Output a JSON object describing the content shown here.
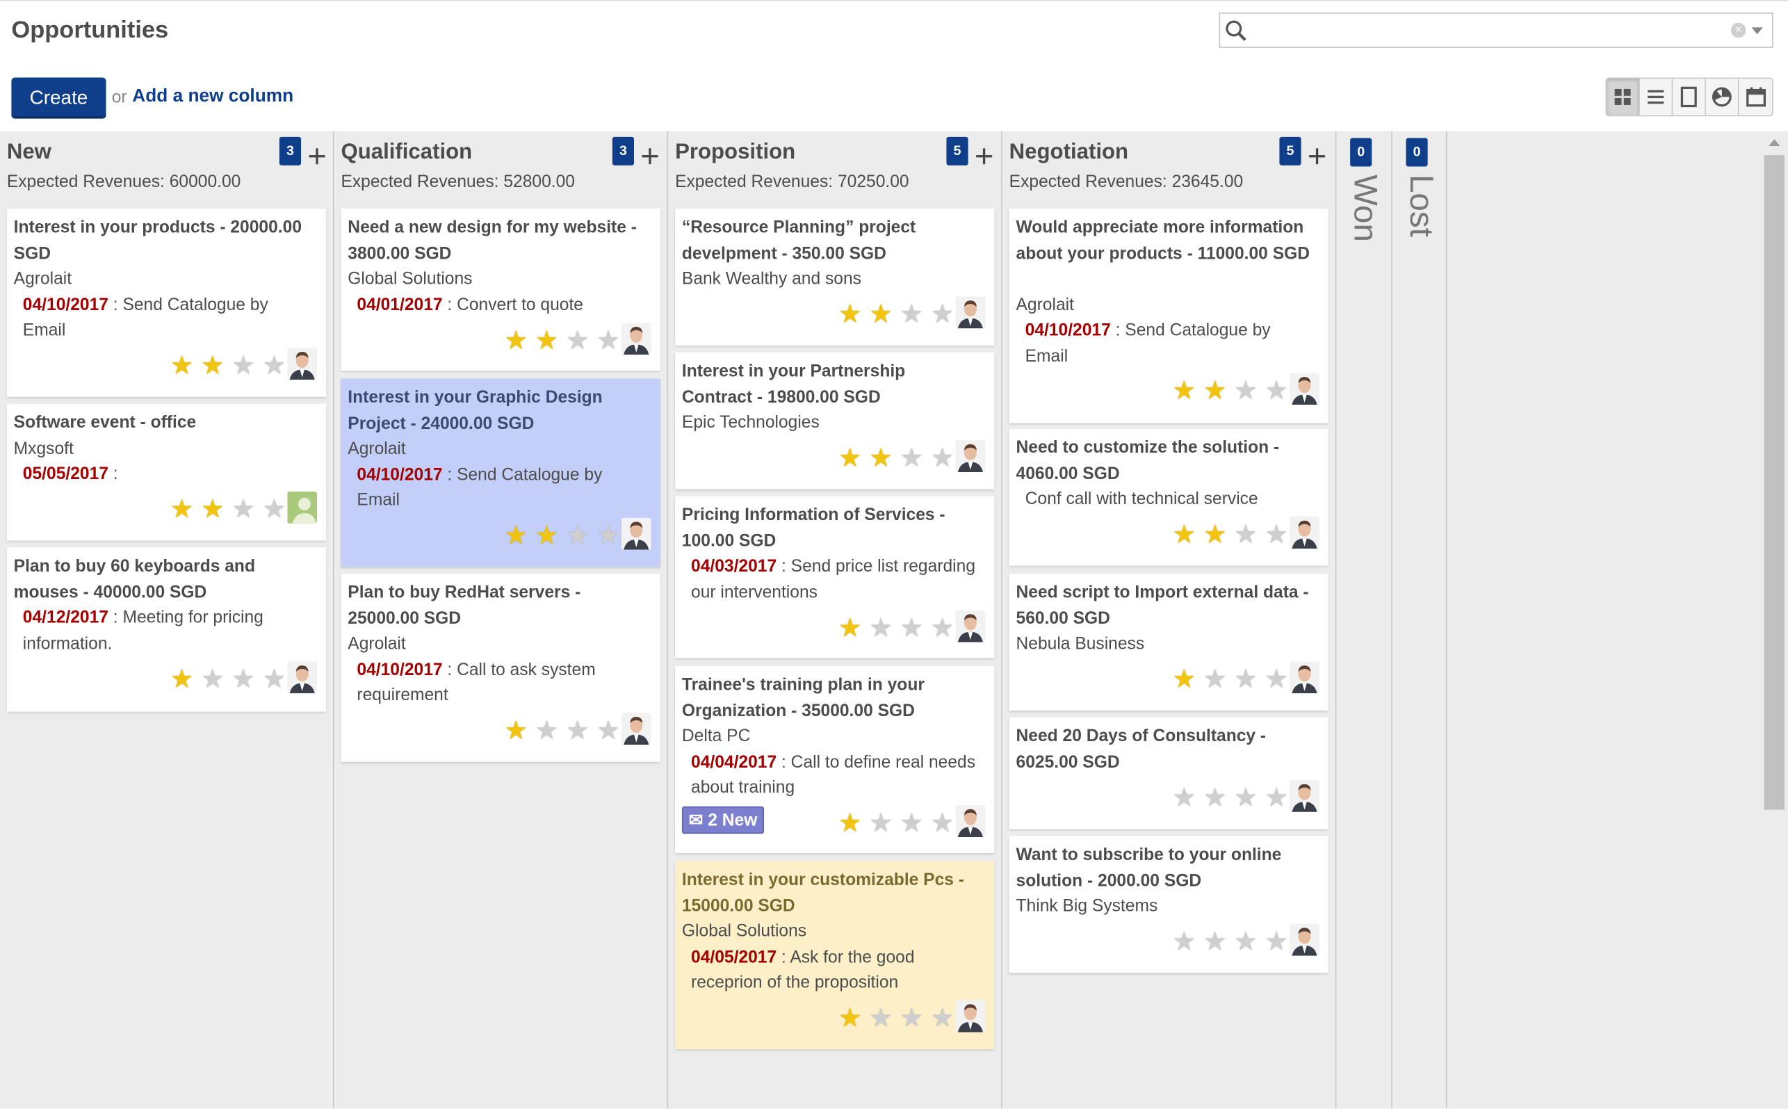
{
  "header": {
    "title": "Opportunities",
    "create_label": "Create",
    "or_label": "or",
    "add_column_label": "Add a new column",
    "search_placeholder": ""
  },
  "views": [
    "kanban-icon",
    "list-icon",
    "form-icon",
    "graph-icon",
    "calendar-icon"
  ],
  "colors": {
    "brand": "#0f3f8a",
    "date": "#a40000",
    "star_on": "#f1c40f",
    "star_off": "#cfcfcf",
    "selected_card": "#c3cff9",
    "highlight_card": "#fdf0c9",
    "new_badge": "#7b7fce"
  },
  "columns": [
    {
      "name": "New",
      "count": "3",
      "revenue": "Expected Revenues: 60000.00",
      "cards": [
        {
          "title": "Interest in your products - 20000.00 SGD",
          "partner": "Agrolait",
          "date": "04/10/2017",
          "action": " : Send Catalogue by Email",
          "stars": 2
        },
        {
          "title": "Software event - office",
          "partner": "Mxgsoft",
          "date": "05/05/2017",
          "action": " :",
          "stars": 2
        },
        {
          "title": "Plan to buy 60 keyboards and mouses - 40000.00 SGD",
          "partner": "",
          "date": "04/12/2017",
          "action": " : Meeting for pricing information.",
          "stars": 1
        }
      ]
    },
    {
      "name": "Qualification",
      "count": "3",
      "revenue": "Expected Revenues: 52800.00",
      "cards": [
        {
          "title": "Need a new design for my website - 3800.00 SGD",
          "partner": "Global Solutions",
          "date": "04/01/2017",
          "action": " : Convert to quote",
          "stars": 2
        },
        {
          "title": "Interest in your Graphic Design Project - 24000.00 SGD",
          "partner": "Agrolait",
          "date": "04/10/2017",
          "action": " : Send Catalogue by Email",
          "stars": 2
        },
        {
          "title": "Plan to buy RedHat servers - 25000.00 SGD",
          "partner": "Agrolait",
          "date": "04/10/2017",
          "action": " : Call to ask system requirement",
          "stars": 1
        }
      ]
    },
    {
      "name": "Proposition",
      "count": "5",
      "revenue": "Expected Revenues: 70250.00",
      "cards": [
        {
          "title": "“Resource Planning” project develpment - 350.00 SGD",
          "partner": "Bank Wealthy and sons",
          "date": "",
          "action": "",
          "stars": 2
        },
        {
          "title": "Interest in your Partnership Contract - 19800.00 SGD",
          "partner": "Epic Technologies",
          "date": "",
          "action": "",
          "stars": 2
        },
        {
          "title": "Pricing Information of Services - 100.00 SGD",
          "partner": "",
          "date": "04/03/2017",
          "action": " : Send price list regarding our interventions",
          "stars": 1
        },
        {
          "title": "Trainee's training plan in your Organization - 35000.00 SGD",
          "partner": "Delta PC",
          "date": "04/04/2017",
          "action": " : Call to define real needs about training",
          "stars": 1,
          "messages": "2 New"
        },
        {
          "title": "Interest in your customizable Pcs - 15000.00 SGD",
          "partner": "Global Solutions",
          "date": "04/05/2017",
          "action": " : Ask for the good receprion of the proposition",
          "stars": 1
        }
      ]
    },
    {
      "name": "Negotiation",
      "count": "5",
      "revenue": "Expected Revenues: 23645.00",
      "cards": [
        {
          "title": "Would appreciate more information about your products - 11000.00 SGD",
          "partner": "Agrolait",
          "date": "04/10/2017",
          "action": " : Send Catalogue by Email",
          "stars": 2
        },
        {
          "title": "Need to customize the solution - 4060.00 SGD",
          "partner": "",
          "date": "",
          "action": "Conf call with technical service",
          "stars": 2
        },
        {
          "title": "Need script to Import external data - 560.00 SGD",
          "partner": "Nebula Business",
          "date": "",
          "action": "",
          "stars": 1
        },
        {
          "title": "Need 20 Days of Consultancy - 6025.00 SGD",
          "partner": "",
          "date": "",
          "action": "",
          "stars": 0
        },
        {
          "title": "Want to subscribe to your online solution - 2000.00 SGD",
          "partner": "Think Big Systems",
          "date": "",
          "action": "",
          "stars": 0
        }
      ]
    }
  ],
  "folded_columns": [
    {
      "name": "Won",
      "count": "0"
    },
    {
      "name": "Lost",
      "count": "0"
    }
  ]
}
